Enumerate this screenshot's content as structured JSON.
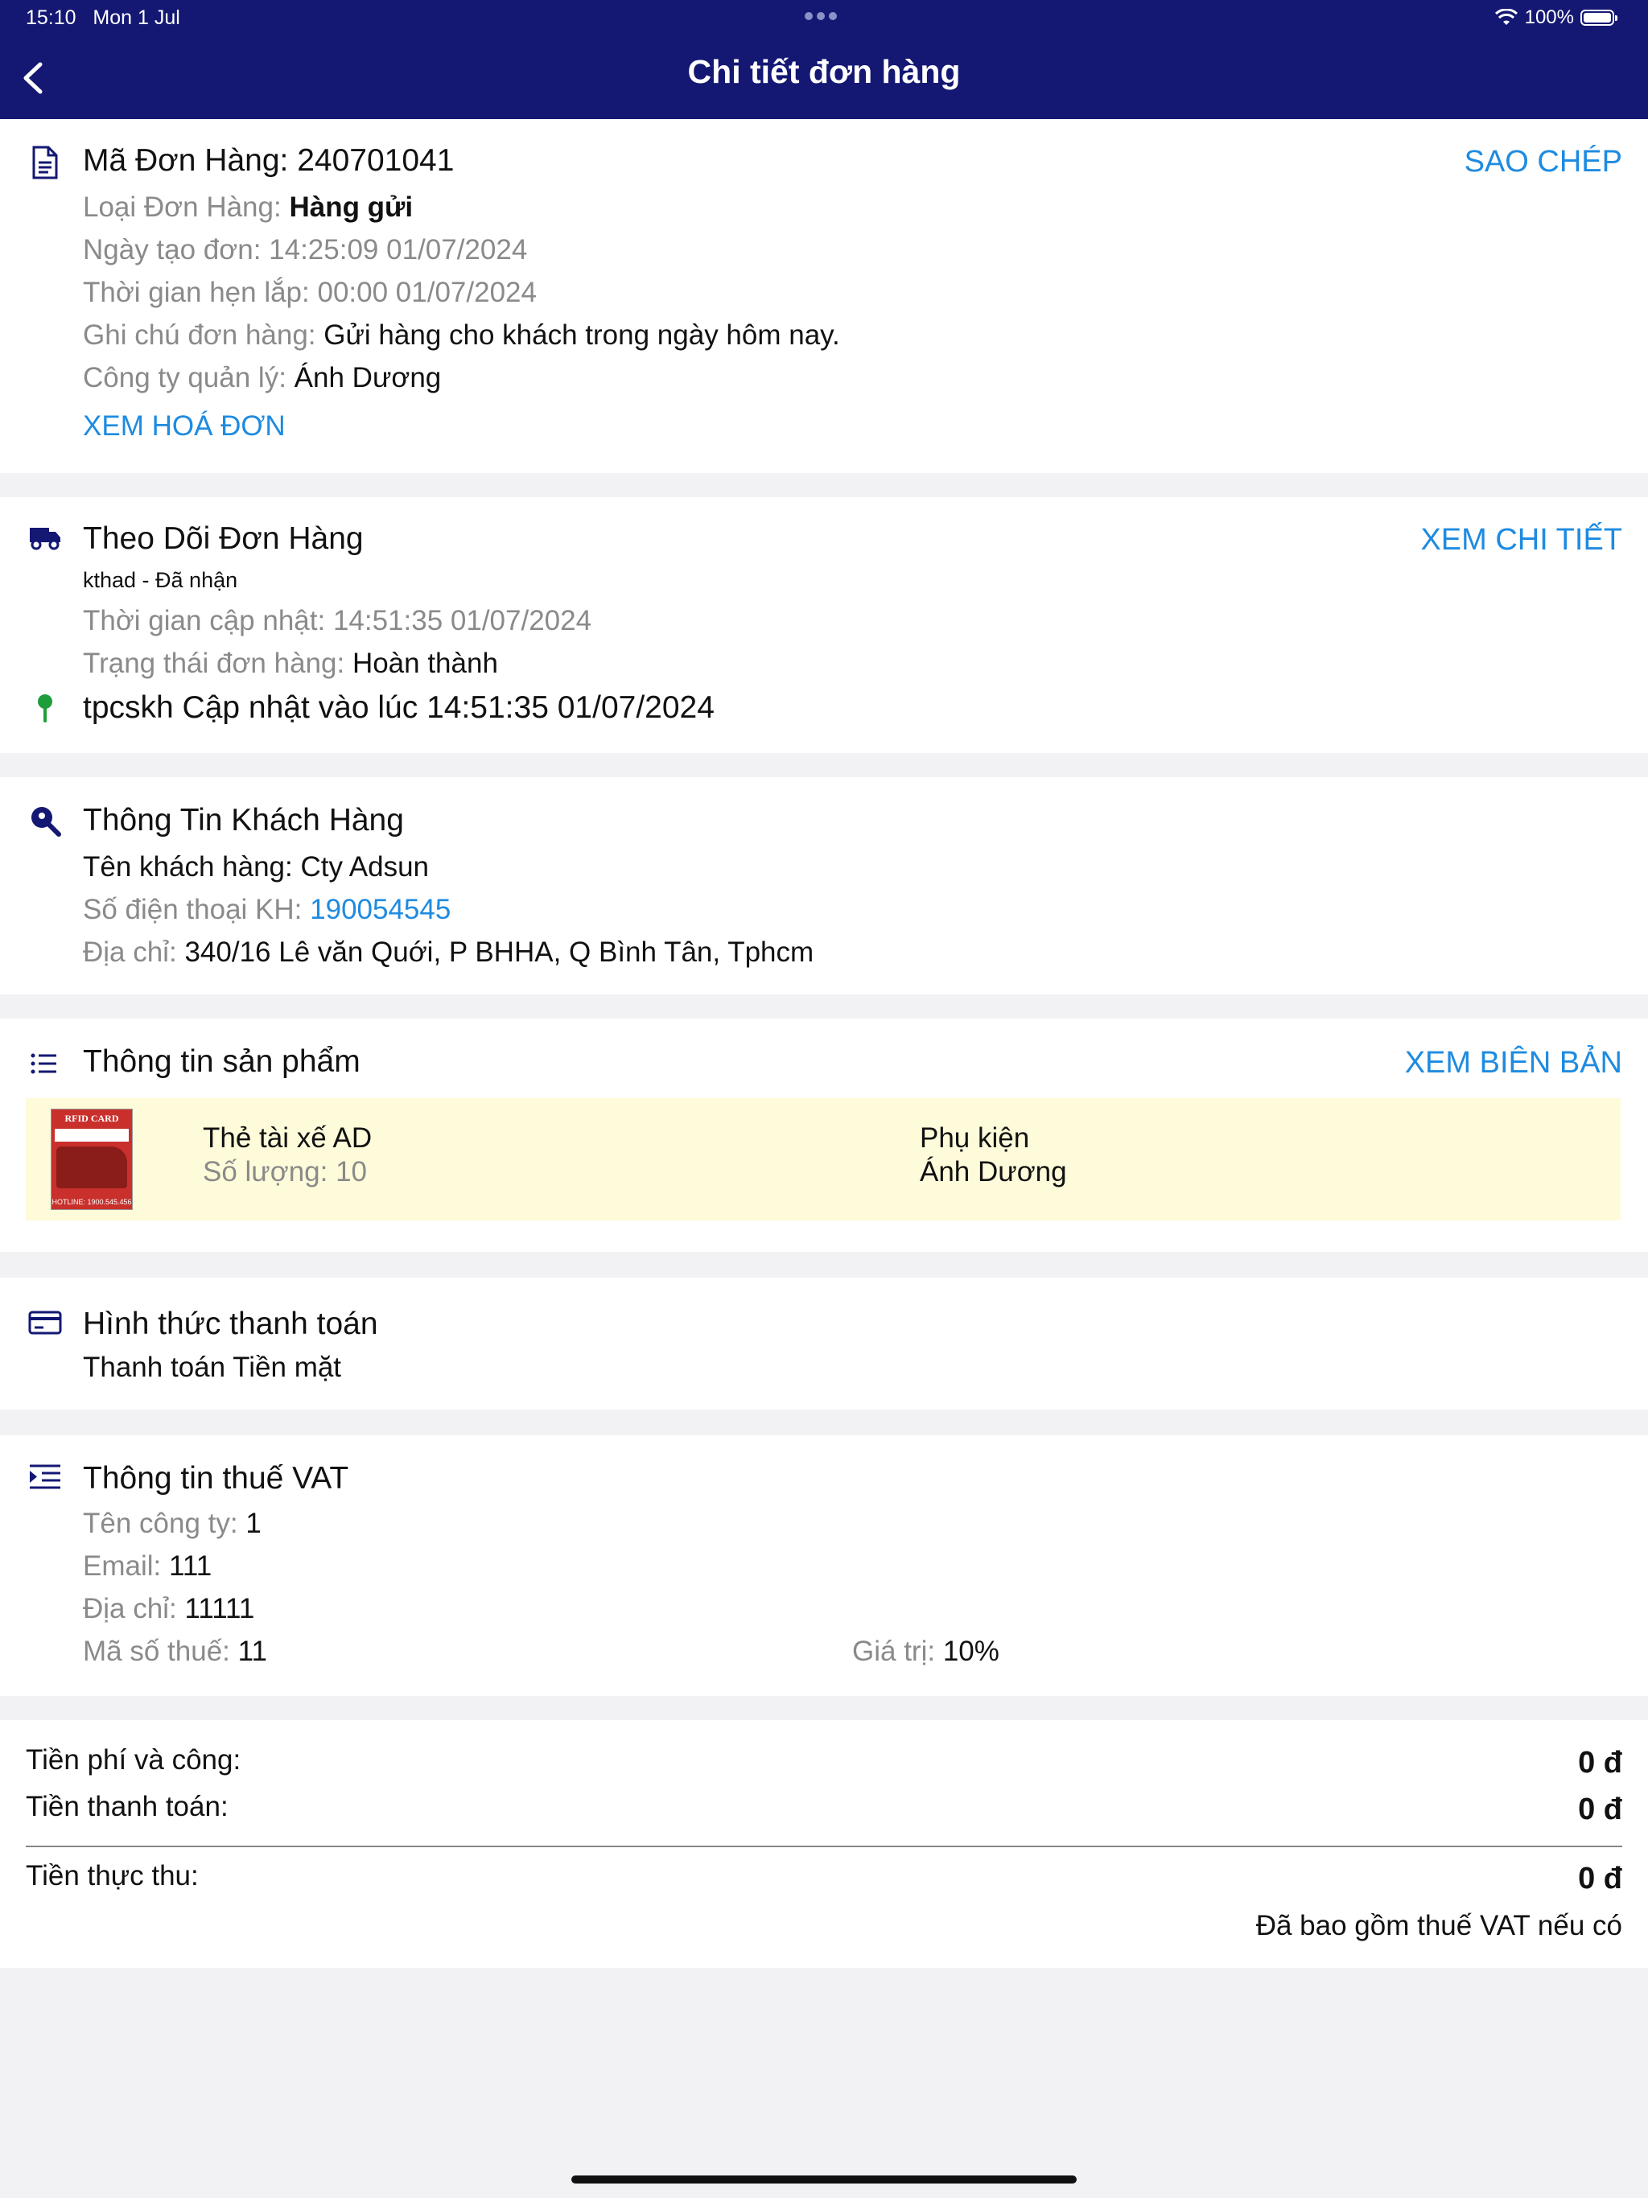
{
  "status_bar": {
    "time": "15:10",
    "date": "Mon 1 Jul",
    "battery": "100%"
  },
  "header": {
    "title": "Chi tiết đơn hàng"
  },
  "order": {
    "code_label": "Mã Đơn Hàng:",
    "code": "240701041",
    "copy_action": "SAO CHÉP",
    "type_label": "Loại Đơn Hàng:",
    "type": "Hàng gửi",
    "created_label": "Ngày tạo đơn:",
    "created": "14:25:09 01/07/2024",
    "install_label": "Thời gian hẹn lắp:",
    "install": "00:00 01/07/2024",
    "note_label": "Ghi chú đơn hàng:",
    "note": "Gửi hàng cho  khách trong ngày hôm nay.",
    "company_label": "Công ty quản lý:",
    "company": "Ánh Dương",
    "invoice_action": "XEM HOÁ ĐƠN"
  },
  "tracking": {
    "title": "Theo Dõi Đơn Hàng",
    "detail_action": "XEM CHI TIẾT",
    "handler": "kthad - Đã nhận",
    "updated_label": "Thời gian cập nhật:",
    "updated": "14:51:35 01/07/2024",
    "status_label": "Trạng thái đơn hàng:",
    "status": "Hoàn thành",
    "last_update": "tpcskh Cập nhật vào lúc 14:51:35 01/07/2024"
  },
  "customer": {
    "title": "Thông Tin Khách Hàng",
    "name_label": "Tên khách hàng:",
    "name": "Cty Adsun",
    "phone_label": "Số điện thoại KH:",
    "phone": "190054545",
    "address_label": "Địa chỉ:",
    "address": "340/16 Lê văn Quới, P BHHA, Q Bình Tân, Tphcm"
  },
  "products": {
    "title": "Thông tin sản phẩm",
    "report_action": "XEM BIÊN BẢN",
    "items": [
      {
        "name": "Thẻ tài xế AD",
        "qty_label": "Số lượng:",
        "qty": "10",
        "category": "Phụ kiện",
        "brand": "Ánh Dương",
        "thumb_text": "RFID CARD",
        "thumb_hotline": "HOTLINE: 1900.545.456"
      }
    ]
  },
  "payment": {
    "title": "Hình thức thanh toán",
    "method": "Thanh toán Tiền mặt"
  },
  "vat": {
    "title": "Thông tin thuế VAT",
    "company_label": "Tên công ty:",
    "company": "1",
    "email_label": "Email:",
    "email": "111",
    "address_label": "Địa chỉ:",
    "address": "11111",
    "tax_label": "Mã số thuế:",
    "tax": "11",
    "value_label": "Giá trị:",
    "value": "10%"
  },
  "summary": {
    "fee_label": "Tiền phí và công:",
    "fee": "0 đ",
    "pay_label": "Tiền thanh toán:",
    "pay": "0 đ",
    "actual_label": "Tiền thực thu:",
    "actual": "0 đ",
    "vat_note": "Đã bao gồm thuế VAT nếu có"
  },
  "colors": {
    "header": "#141873",
    "accent": "#1e8be0",
    "product_bg": "#fdfbd9",
    "pin": "#1e9e3a"
  }
}
